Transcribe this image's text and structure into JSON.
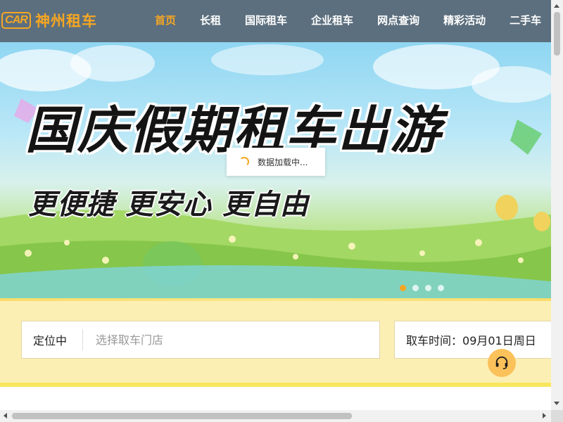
{
  "logo": {
    "badge": "CAR",
    "name": "神州租车"
  },
  "nav": {
    "items": [
      {
        "label": "首页",
        "active": true
      },
      {
        "label": "长租",
        "active": false
      },
      {
        "label": "国际租车",
        "active": false
      },
      {
        "label": "企业租车",
        "active": false
      },
      {
        "label": "网点查询",
        "active": false
      },
      {
        "label": "精彩活动",
        "active": false
      },
      {
        "label": "二手车",
        "active": false
      }
    ]
  },
  "banner": {
    "headline": "国庆假期租车出游",
    "subline": "更便捷 更安心 更自由",
    "slide_count": 4,
    "active_slide": 1
  },
  "loading": {
    "text": "数据加载中..."
  },
  "search": {
    "location_label": "定位中",
    "store_placeholder": "选择取车门店",
    "pickup_label": "取车时间：",
    "pickup_value": "09月01日周日"
  },
  "colors": {
    "accent": "#f5a623",
    "nav_bg": "#5c6f7e",
    "panel_bg": "#fcefb4",
    "cs_button": "#fbc15a"
  },
  "icons": {
    "customer_service": "headset-icon",
    "spinner": "loading-spinner-icon"
  }
}
